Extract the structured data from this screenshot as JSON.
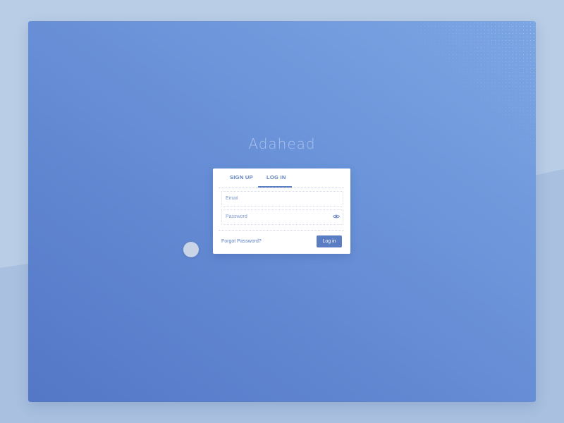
{
  "brand": {
    "name": "Adahead"
  },
  "auth_card": {
    "tabs": [
      {
        "label": "SIGN UP",
        "active": false
      },
      {
        "label": "LOG IN",
        "active": true
      }
    ],
    "email": {
      "placeholder": "Email",
      "value": ""
    },
    "password": {
      "placeholder": "Password",
      "value": "",
      "toggle_icon": "eye-icon"
    },
    "forgot_password_label": "Forgot Password?",
    "submit_label": "Log in"
  },
  "colors": {
    "accent": "#5b7fc2",
    "button": "#5a7dc4",
    "canvas_light": "#7ba6e3",
    "canvas_dark": "#5477c6",
    "page_background": "#b9cde6"
  }
}
